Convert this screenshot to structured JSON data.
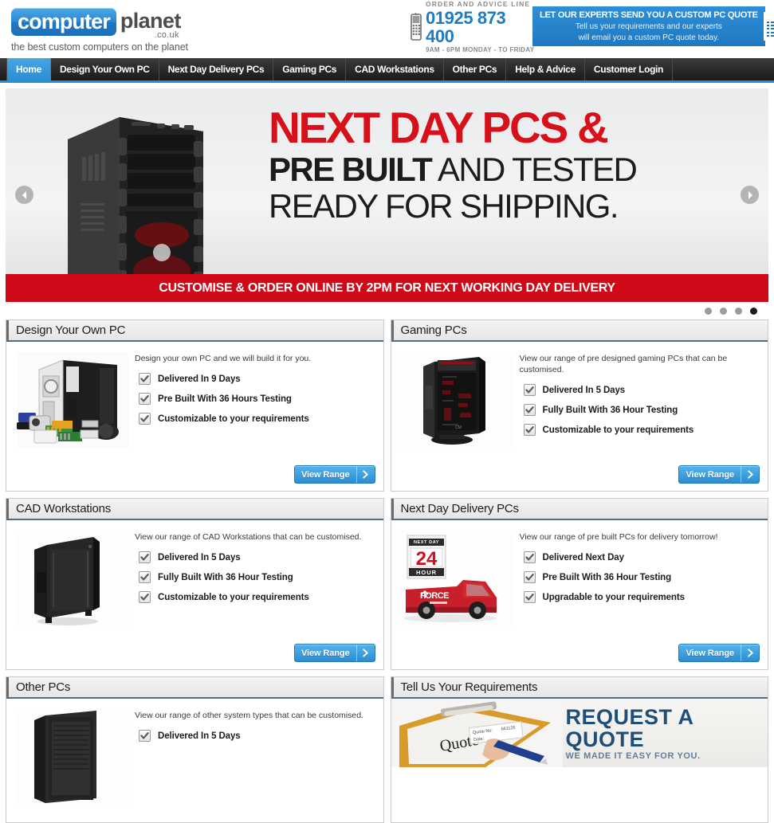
{
  "header": {
    "logo": {
      "badge_text": "computer",
      "brand_text": "planet",
      "tld": ".co.uk",
      "tagline": "the best custom computers on the planet"
    },
    "phone": {
      "label": "ORDER AND ADVICE LINE",
      "number": "01925 873 400",
      "hours": "9AM - 6PM MONDAY - TO FRIDAY"
    },
    "quote_banner": {
      "headline": "LET OUR EXPERTS SEND YOU A CUSTOM PC QUOTE",
      "line1": "Tell us your requirements and our experts",
      "line2": "will email you a custom PC quote today."
    }
  },
  "nav": {
    "items": [
      {
        "label": "Home",
        "active": true
      },
      {
        "label": "Design Your Own PC",
        "active": false
      },
      {
        "label": "Next Day Delivery PCs",
        "active": false
      },
      {
        "label": "Gaming PCs",
        "active": false
      },
      {
        "label": "CAD Workstations",
        "active": false
      },
      {
        "label": "Other PCs",
        "active": false
      },
      {
        "label": "Help & Advice",
        "active": false
      },
      {
        "label": "Customer Login",
        "active": false
      }
    ]
  },
  "hero": {
    "line1": "NEXT DAY PCS &",
    "line2_bold": "PRE BUILT",
    "line2_rest": " AND TESTED",
    "line3": "READY FOR SHIPPING.",
    "strip": "CUSTOMISE & ORDER ONLINE BY 2PM FOR NEXT WORKING DAY DELIVERY",
    "dots": [
      false,
      false,
      false,
      true
    ]
  },
  "cards": [
    {
      "title": "Design Your Own PC",
      "desc": "Design your own PC and we will build it for you.",
      "features": [
        "Delivered In 9 Days",
        "Pre Built With 36 Hours Testing",
        "Customizable to your requirements"
      ],
      "button": "View Range",
      "image": "pc-parts-image"
    },
    {
      "title": "Gaming PCs",
      "desc": "View our range of pre designed gaming PCs that can be customised.",
      "features": [
        "Delivered In 5 Days",
        "Fully Built With 36 Hour Testing",
        "Customizable to your requirements"
      ],
      "button": "View Range",
      "image": "gaming-tower-image"
    },
    {
      "title": "CAD Workstations",
      "desc": "View our range of CAD Workstations that can be customised.",
      "features": [
        "Delivered In 5 Days",
        "Fully Built With 36 Hour Testing",
        "Customizable to your requirements"
      ],
      "button": "View Range",
      "image": "cad-tower-image"
    },
    {
      "title": "Next Day Delivery PCs",
      "desc": "View our range of pre built PCs for delivery tomorrow!",
      "features": [
        "Delivered Next Day",
        "Pre Built With 36 Hour Testing",
        "Upgradable to your requirements"
      ],
      "button": "View Range",
      "image": "delivery-van-image",
      "badge_number": "24",
      "badge_top": "NEXT DAY",
      "badge_bottom": "HOUR",
      "van_text": "FORCE"
    },
    {
      "title": "Other PCs",
      "desc": "View our range of other system types that can be customised.",
      "features": [
        "Delivered In 5 Days"
      ],
      "image": "other-tower-image"
    },
    {
      "title": "Tell Us Your Requirements",
      "promo_headline": "REQUEST A QUOTE",
      "promo_sub": "WE MADE IT EASY FOR YOU.",
      "clipboard_word": "Quote",
      "clipboard_field1": "Quote No:",
      "clipboard_field2": "Date:",
      "clipboard_number": "661126"
    }
  ],
  "colors": {
    "brand_blue": "#2a8ed4",
    "hero_red": "#d8101a",
    "strip_red": "#cf0a18",
    "nav_dark": "#1b1b1b",
    "card_head_accent": "#4d6f8c",
    "promo_navy": "#1f4e79"
  }
}
